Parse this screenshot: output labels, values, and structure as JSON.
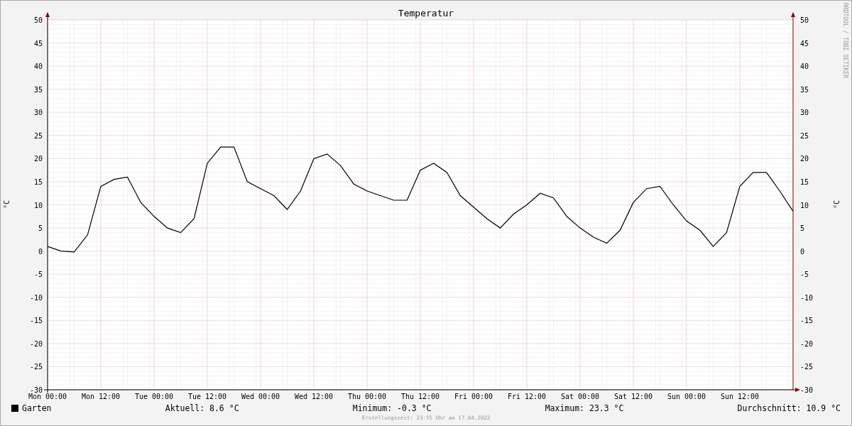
{
  "title": "Temperatur",
  "chart_data": {
    "type": "line",
    "grid": true,
    "ylabel": "°C",
    "ylim": [
      -30,
      50
    ],
    "yticks": [
      -30,
      -25,
      -20,
      -15,
      -10,
      -5,
      0,
      5,
      10,
      15,
      20,
      25,
      30,
      35,
      40,
      45,
      50
    ],
    "categories": [
      "Mon 00:00",
      null,
      null,
      null,
      "Mon 12:00",
      null,
      null,
      null,
      "Tue 00:00",
      null,
      null,
      null,
      "Tue 12:00",
      null,
      null,
      null,
      "Wed 00:00",
      null,
      null,
      null,
      "Wed 12:00",
      null,
      null,
      null,
      "Thu 00:00",
      null,
      null,
      null,
      "Thu 12:00",
      null,
      null,
      null,
      "Fri 00:00",
      null,
      null,
      null,
      "Fri 12:00",
      null,
      null,
      null,
      "Sat 00:00",
      null,
      null,
      null,
      "Sat 12:00",
      null,
      null,
      null,
      "Sun 00:00",
      null,
      null,
      null,
      "Sun 12:00",
      null,
      null,
      null,
      null
    ],
    "series": [
      {
        "name": "Garten",
        "color": "#000000",
        "values": [
          1.0,
          0.0,
          -0.2,
          3.5,
          14,
          15.5,
          16,
          10.5,
          7.5,
          5,
          4,
          7,
          19,
          22.5,
          22.5,
          15,
          13.5,
          12,
          9,
          13,
          20,
          21,
          18.5,
          14.5,
          13,
          12,
          11,
          11,
          17.5,
          19,
          17,
          12,
          9.5,
          7,
          5,
          8,
          10,
          12.5,
          11.5,
          7.5,
          5,
          3,
          1.7,
          4.5,
          10.5,
          13.5,
          14,
          10,
          6.5,
          4.5,
          1,
          4,
          14,
          17,
          17,
          13,
          8.6
        ]
      }
    ]
  },
  "right_yticks": [
    "50",
    "45",
    "40",
    "35",
    "30",
    "25",
    "20",
    "15",
    "10",
    "5",
    "0",
    "-5",
    "-10",
    "-15",
    "-20",
    "-25",
    "-30"
  ],
  "right_ylabel": "°C",
  "side_credit": "RRDTOOL / TOBI OETIKER",
  "stats": [
    "Aktuell: 8.6 °C",
    "Minimum: -0.3 °C",
    "Maximum: 23.3 °C",
    "Durchschnitt: 10.9 °C"
  ],
  "footer": "Erstellungszeit: 23:55 Uhr am 17.04.2022"
}
